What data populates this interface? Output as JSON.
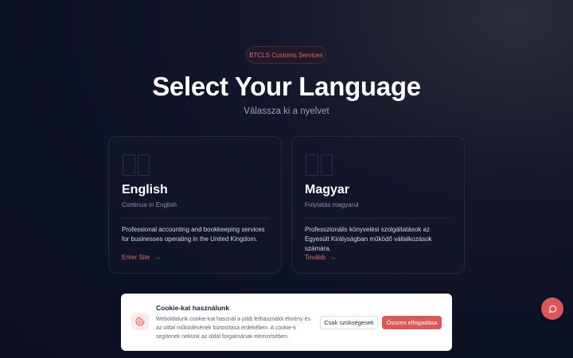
{
  "badge": "BTCLS Customs Services",
  "header": {
    "title": "Select Your Language",
    "subtitle": "Válassza ki a nyelvet"
  },
  "cards": [
    {
      "title": "English",
      "subtitle": "Continue in English",
      "description": "Professional accounting and bookkeeping services for businesses operating in the United Kingdom.",
      "link": "Enter Site"
    },
    {
      "title": "Magyar",
      "subtitle": "Folytatás magyarul",
      "description": "Professzionális könyvelési szolgáltatások az Egyesült Királyságban működő vállalkozások számára.",
      "link": "Tovább"
    }
  ],
  "cookie": {
    "title": "Cookie-kat használunk",
    "text": "Weboldalunk cookie-kat használ a jobb felhasználói élmény és az oldal működésének biztosítása érdekében. A cookie-k segítenek nekünk az oldal forgalmának elemzésében.",
    "necessary_label": "Csak szükségesek",
    "accept_label": "Összes elfogadása"
  },
  "colors": {
    "accent": "#d9595a",
    "background": "#0d1124"
  },
  "icons": {
    "flag": "flag-icon",
    "arrow": "arrow-right-icon",
    "cookie": "cookie-icon",
    "chat": "chat-icon"
  }
}
